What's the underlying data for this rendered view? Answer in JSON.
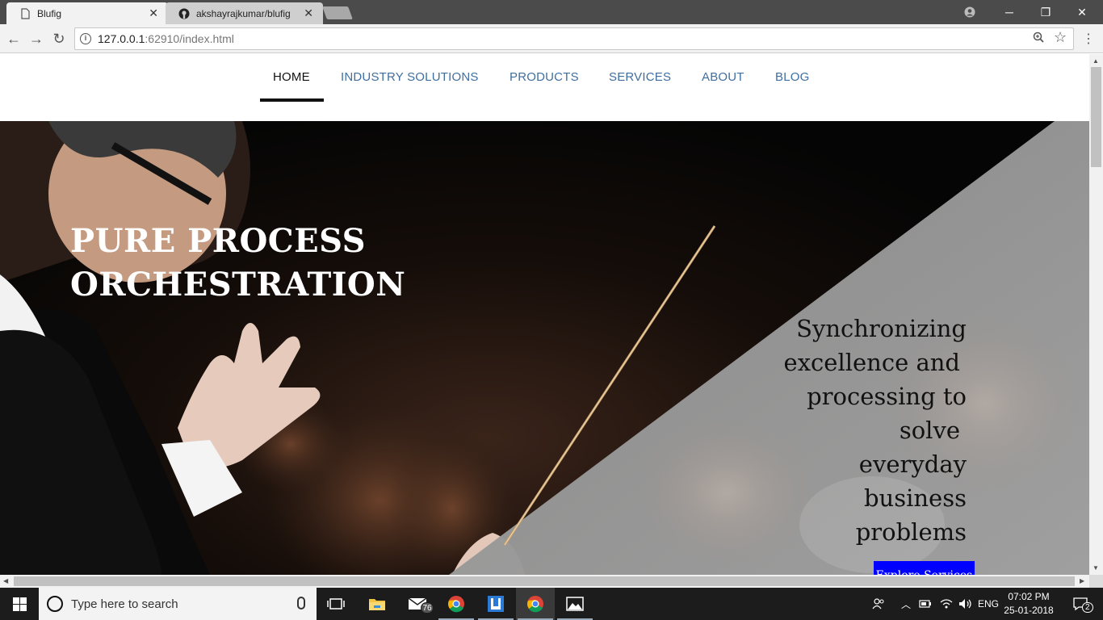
{
  "browser": {
    "tabs": [
      {
        "title": "Blufig"
      },
      {
        "title": "akshayrajkumar/blufig"
      }
    ],
    "url_host": "127.0.0.1",
    "url_rest": ":62910/index.html"
  },
  "site": {
    "nav": [
      "HOME",
      "INDUSTRY SOLUTIONS",
      "PRODUCTS",
      "SERVICES",
      "ABOUT",
      "BLOG"
    ],
    "active_nav": "HOME",
    "hero": {
      "title_line1": "PURE PROCESS",
      "title_line2": "ORCHESTRATION",
      "tagline_lines": [
        "Synchronizing",
        "excellence and",
        "processing to",
        "solve",
        "everyday",
        "business",
        "problems"
      ],
      "button_label": "Explore Services"
    },
    "accent_color": "#0000ff",
    "nav_link_color": "#3f6fa0"
  },
  "taskbar": {
    "search_placeholder": "Type here to search",
    "mail_badge": "76",
    "language": "ENG",
    "time": "07:02 PM",
    "date": "25-01-2018",
    "notification_count": "2"
  }
}
